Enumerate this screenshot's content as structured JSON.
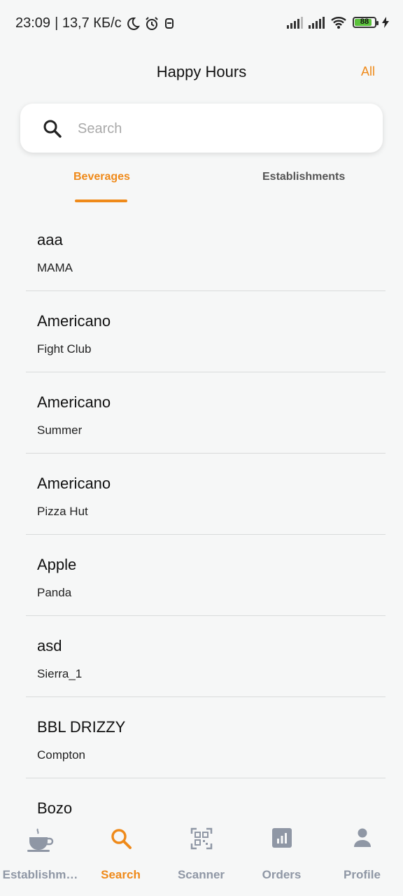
{
  "status_bar": {
    "time": "23:09",
    "speed": "| 13,7 КБ/с",
    "battery": "88"
  },
  "header": {
    "title": "Happy Hours",
    "all_label": "All"
  },
  "search": {
    "placeholder": "Search",
    "value": ""
  },
  "tabs": [
    {
      "label": "Beverages",
      "active": true
    },
    {
      "label": "Establishments",
      "active": false
    }
  ],
  "items": [
    {
      "title": "aaa",
      "subtitle": "MAMA"
    },
    {
      "title": "Americano",
      "subtitle": "Fight Club"
    },
    {
      "title": "Americano",
      "subtitle": "Summer"
    },
    {
      "title": "Americano",
      "subtitle": "Pizza Hut"
    },
    {
      "title": "Apple",
      "subtitle": "Panda"
    },
    {
      "title": "asd",
      "subtitle": "Sierra_1"
    },
    {
      "title": "BBL DRIZZY",
      "subtitle": "Compton"
    },
    {
      "title": "Bozo",
      "subtitle": ""
    }
  ],
  "bottom_nav": [
    {
      "label": "Establishm…",
      "icon": "coffee-cup-icon",
      "active": false
    },
    {
      "label": "Search",
      "icon": "search-icon",
      "active": true
    },
    {
      "label": "Scanner",
      "icon": "qr-code-icon",
      "active": false
    },
    {
      "label": "Orders",
      "icon": "bar-chart-icon",
      "active": false
    },
    {
      "label": "Profile",
      "icon": "person-icon",
      "active": false
    }
  ],
  "colors": {
    "accent": "#ef8a1a",
    "inactive": "#8f97a5",
    "background": "#f6f7f7"
  }
}
